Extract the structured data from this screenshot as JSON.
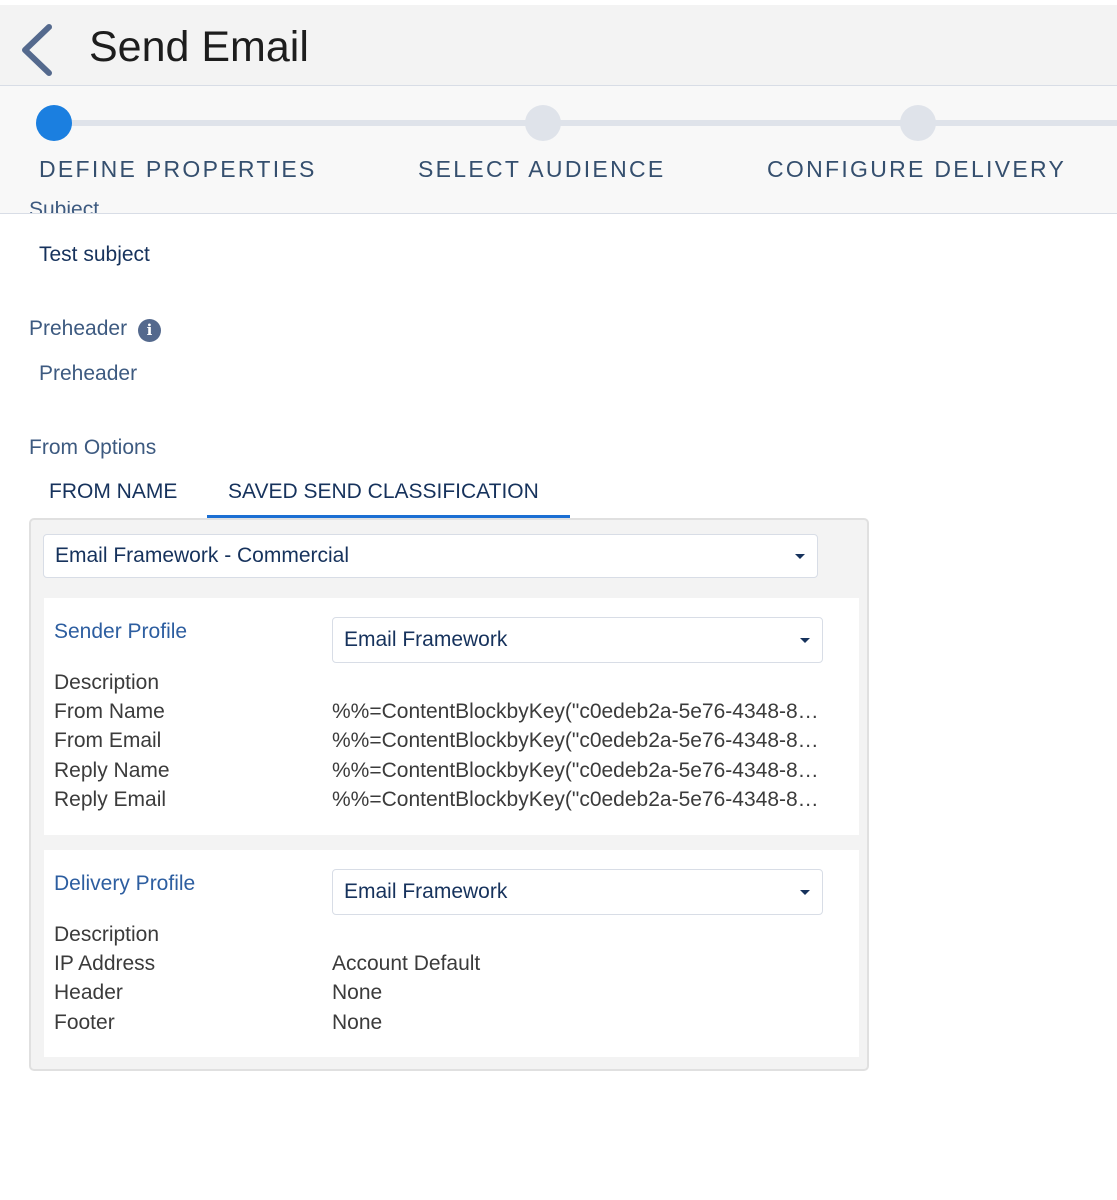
{
  "header": {
    "title": "Send Email",
    "back_icon": "chevron-left-icon"
  },
  "steps": [
    {
      "label": "DEFINE PROPERTIES",
      "active": true
    },
    {
      "label": "SELECT AUDIENCE",
      "active": false
    },
    {
      "label": "CONFIGURE DELIVERY",
      "active": false
    }
  ],
  "fields": {
    "subject_label": "Subject",
    "subject_value": "Test subject",
    "preheader_label": "Preheader",
    "preheader_info_icon": "info-icon",
    "preheader_value": "Preheader",
    "from_options_label": "From Options"
  },
  "tabs": [
    {
      "label": "FROM NAME",
      "selected": false
    },
    {
      "label": "SAVED SEND CLASSIFICATION",
      "selected": true
    }
  ],
  "classification_select": {
    "value": "Email Framework - Commercial"
  },
  "sender_profile": {
    "title": "Sender Profile",
    "select_value": "Email Framework",
    "rows": [
      {
        "label": "Description",
        "value": ""
      },
      {
        "label": "From Name",
        "value": "%%=ContentBlockbyKey(\"c0edeb2a-5e76-4348-8…"
      },
      {
        "label": "From Email",
        "value": "%%=ContentBlockbyKey(\"c0edeb2a-5e76-4348-8…"
      },
      {
        "label": "Reply Name",
        "value": "%%=ContentBlockbyKey(\"c0edeb2a-5e76-4348-8…"
      },
      {
        "label": "Reply Email",
        "value": "%%=ContentBlockbyKey(\"c0edeb2a-5e76-4348-8…"
      }
    ]
  },
  "delivery_profile": {
    "title": "Delivery Profile",
    "select_value": "Email Framework",
    "rows": [
      {
        "label": "Description",
        "value": ""
      },
      {
        "label": "IP Address",
        "value": "Account Default"
      },
      {
        "label": "Header",
        "value": "None"
      },
      {
        "label": "Footer",
        "value": "None"
      }
    ]
  },
  "colors": {
    "accent": "#1b7fe0",
    "label": "#3d5a80",
    "text": "#16325c"
  }
}
